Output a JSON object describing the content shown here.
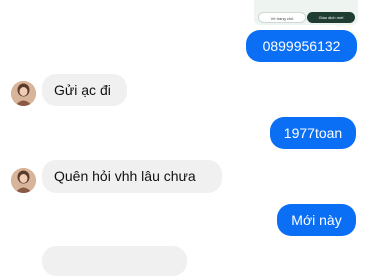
{
  "card": {
    "home_label": "Về trang chủ",
    "trade_label": "Giao dịch mới"
  },
  "messages": [
    {
      "direction": "out",
      "text": "0899956132"
    },
    {
      "direction": "in",
      "text": "Gửi ạc đi"
    },
    {
      "direction": "out",
      "text": "1977toan"
    },
    {
      "direction": "in",
      "text": "Quên hỏi vhh lâu chưa"
    },
    {
      "direction": "out",
      "text": "Mới này"
    },
    {
      "direction": "in",
      "text": ""
    }
  ],
  "colors": {
    "outgoing_bubble": "#0a6ff5",
    "incoming_bubble": "#f0f0f0",
    "trade_button": "#1f3d33"
  }
}
